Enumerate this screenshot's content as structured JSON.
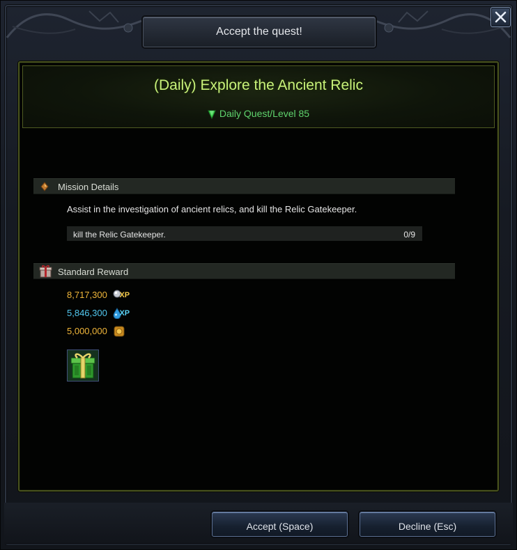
{
  "window": {
    "title": "Accept the quest!",
    "close_icon": "close-icon"
  },
  "quest": {
    "title": "(Daily) Explore the Ancient Relic",
    "subtitle": "Daily Quest/Level 85",
    "subtitle_icon": "green-gem-icon"
  },
  "mission": {
    "header": "Mission Details",
    "icon": "compass-icon",
    "description": "Assist in the investigation of ancient relics, and kill the Relic Gatekeeper.",
    "objective": {
      "text": "kill the Relic Gatekeeper.",
      "progress": "0/9"
    }
  },
  "reward": {
    "header": "Standard Reward",
    "icon": "gift-box-icon",
    "items": [
      {
        "value": "8,717,300",
        "icon": "silver-xp-icon",
        "tag": "XP",
        "color": "#f0b63a",
        "tag_color": "#f2c84b"
      },
      {
        "value": "5,846,300",
        "icon": "blue-xp-icon",
        "tag": "XP",
        "color": "#52c8f0",
        "tag_color": "#5ad2f5"
      },
      {
        "value": "5,000,000",
        "icon": "gold-coin-icon",
        "tag": "",
        "color": "#f0b63a",
        "tag_color": "#f0b63a"
      }
    ],
    "item_slot_icon": "green-gift-icon"
  },
  "buttons": {
    "accept": "Accept (Space)",
    "decline": "Decline (Esc)"
  }
}
